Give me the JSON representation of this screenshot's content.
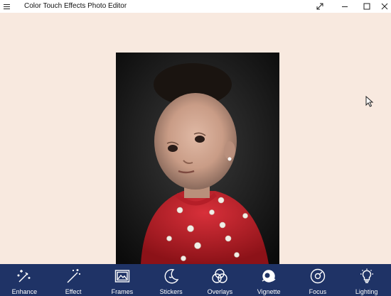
{
  "window": {
    "title": "Color Touch Effects Photo Editor",
    "menu_icon": "hamburger-menu-icon",
    "controls": [
      "expand-icon",
      "minimize-icon",
      "maximize-icon",
      "close-icon"
    ]
  },
  "canvas": {
    "background": "#f8e9df",
    "photo_alt": "Child in red embroidered outfit"
  },
  "toolbar": {
    "background": "#1f3366",
    "items": [
      {
        "label": "Enhance",
        "icon": "wand-sparkle-icon"
      },
      {
        "label": "Effect",
        "icon": "magic-wand-icon"
      },
      {
        "label": "Frames",
        "icon": "picture-frame-icon"
      },
      {
        "label": "Stickers",
        "icon": "moon-sticker-icon"
      },
      {
        "label": "Overlays",
        "icon": "overlapping-circles-icon"
      },
      {
        "label": "Vignette",
        "icon": "vignette-icon"
      },
      {
        "label": "Focus",
        "icon": "focus-target-icon"
      },
      {
        "label": "Lighting",
        "icon": "lightbulb-icon"
      }
    ]
  }
}
